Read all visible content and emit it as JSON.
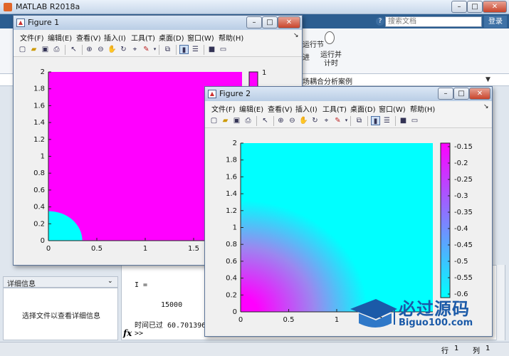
{
  "main_window": {
    "title": "MATLAB R2018a",
    "search_placeholder": "搜索文档",
    "search_button": "登录",
    "ribbon": {
      "run_section_partial": "运行节",
      "advance_partial": "进",
      "run_time_label_line1": "运行并",
      "run_time_label_line2": "计时"
    },
    "current_path": "场耦合分析案例",
    "details_panel": {
      "title": "详细信息",
      "message": "选择文件以查看详细信息"
    },
    "command_window": {
      "lines": [
        "I =",
        "15000",
        "时间已过 60.701396 秒"
      ],
      "prompt": ">>"
    },
    "status": {
      "row_label": "行",
      "row": "1",
      "col_label": "列",
      "col": "1"
    }
  },
  "figure1": {
    "title": "Figure 1",
    "menu": [
      "文件(F)",
      "编辑(E)",
      "查看(V)",
      "插入(I)",
      "工具(T)",
      "桌面(D)",
      "窗口(W)",
      "帮助(H)"
    ],
    "colors": {
      "field": "#ff00ff",
      "corner": "#00ffff"
    },
    "chart_data": {
      "type": "heatmap",
      "xlim": [
        0,
        2
      ],
      "ylim": [
        0,
        2
      ],
      "x_ticks": [
        "0",
        "0.5",
        "1",
        "1.5"
      ],
      "y_ticks": [
        "0",
        "0.2",
        "0.4",
        "0.6",
        "0.8",
        "1",
        "1.2",
        "1.4",
        "1.6",
        "1.8",
        "2"
      ],
      "colorbar_ticks": [
        "1"
      ],
      "corner_radius": 0.35
    }
  },
  "figure2": {
    "title": "Figure 2",
    "menu": [
      "文件(F)",
      "编辑(E)",
      "查看(V)",
      "插入(I)",
      "工具(T)",
      "桌面(D)",
      "窗口(W)",
      "帮助(H)"
    ],
    "colors": {
      "high": "#00ffff",
      "low": "#ff00ff"
    },
    "chart_data": {
      "type": "heatmap",
      "xlim": [
        0,
        2
      ],
      "ylim": [
        0,
        2
      ],
      "x_ticks": [
        "0",
        "0.5",
        "1",
        "1.5"
      ],
      "y_ticks": [
        "0",
        "0.2",
        "0.4",
        "0.6",
        "0.8",
        "1",
        "1.2",
        "1.4",
        "1.6",
        "1.8",
        "2"
      ],
      "colorbar_ticks": [
        "-0.15",
        "-0.2",
        "-0.25",
        "-0.3",
        "-0.35",
        "-0.4",
        "-0.45",
        "-0.5",
        "-0.55",
        "-0.6"
      ]
    }
  },
  "watermark": {
    "cn": "必过源码",
    "en": "Biguo100.com"
  }
}
